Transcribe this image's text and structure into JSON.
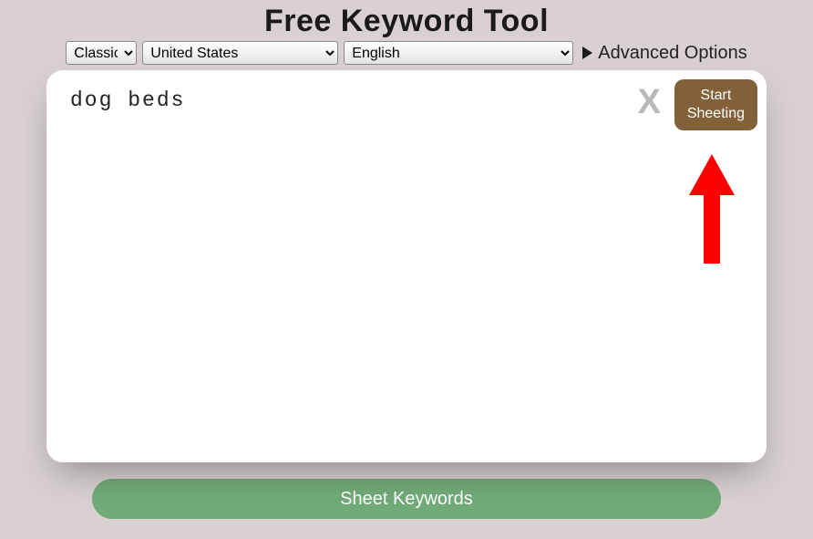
{
  "title": "Free Keyword Tool",
  "selects": {
    "mode": "Classic",
    "country": "United States",
    "language": "English"
  },
  "advanced_label": "Advanced Options",
  "input": {
    "value": "dog beds",
    "placeholder": ""
  },
  "clear_glyph": "X",
  "start_button": {
    "line1": "Start",
    "line2": "Sheeting"
  },
  "bottom_button": "Sheet Keywords",
  "colors": {
    "accent_brown": "#826038",
    "accent_green": "#71ab78",
    "arrow_red": "#fa0202"
  }
}
